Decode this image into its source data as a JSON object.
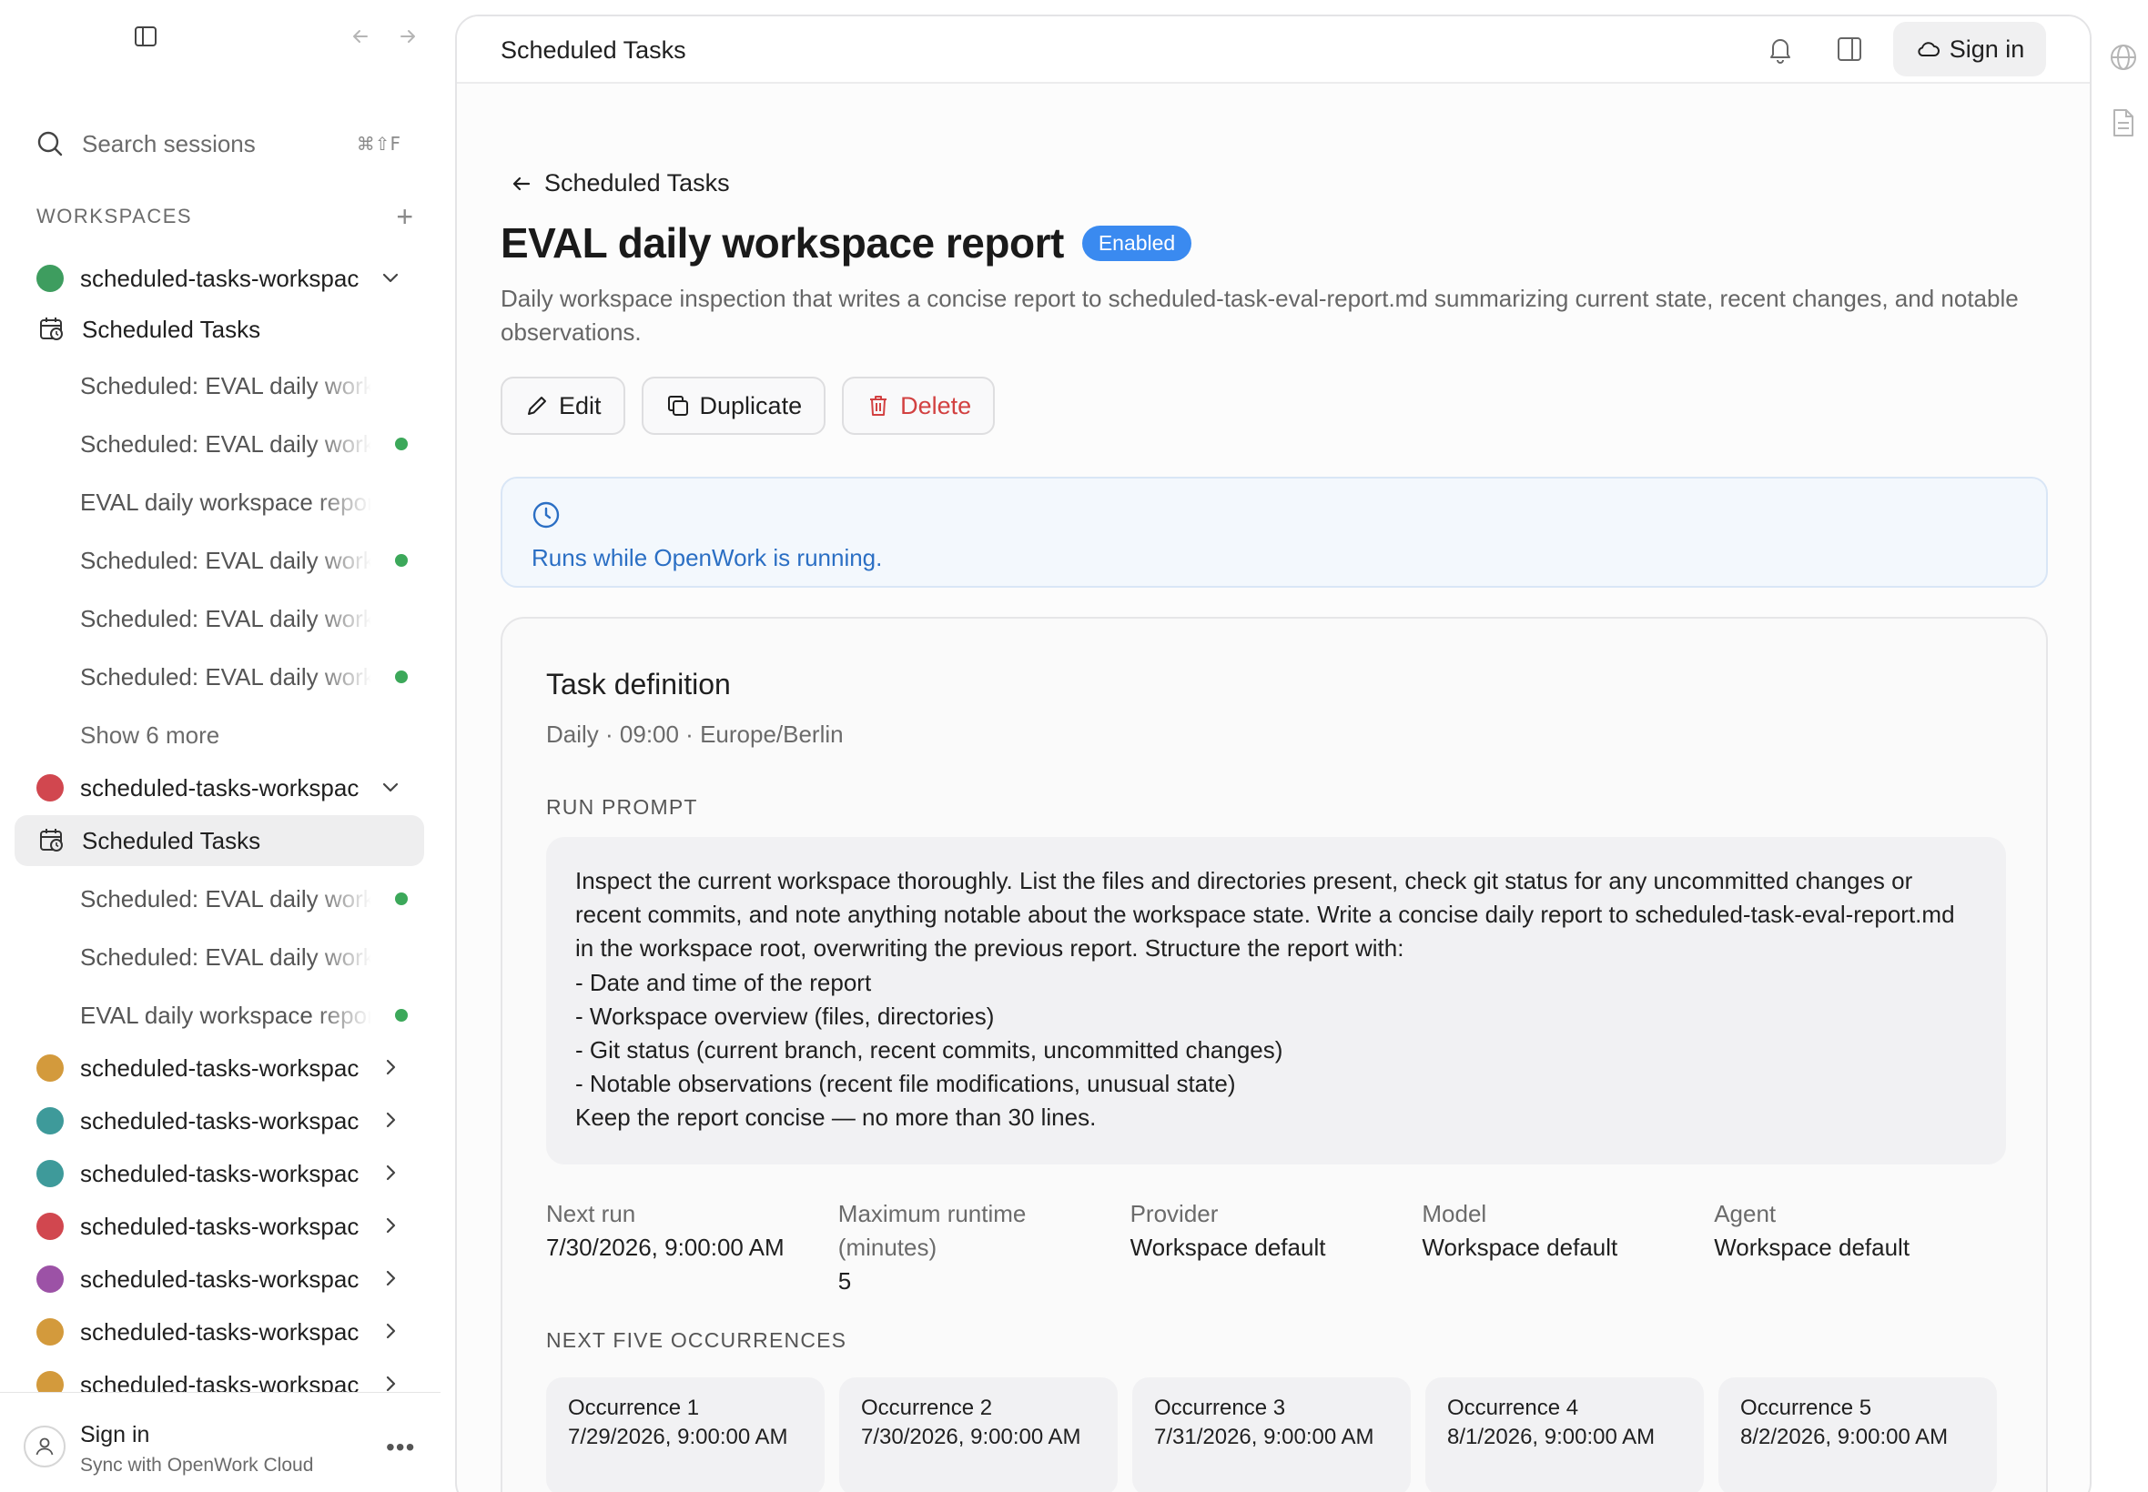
{
  "sidebar": {
    "search": {
      "label": "Search sessions",
      "shortcut": "⌘⇧F"
    },
    "workspaces_header": "WORKSPACES",
    "workspace_name": "scheduled-tasks-workspac",
    "scheduled_tasks_label": "Scheduled Tasks",
    "group1": {
      "color": "#3e9d5f",
      "items": [
        {
          "label": "Scheduled: EVAL daily workspace report",
          "dot": false
        },
        {
          "label": "Scheduled: EVAL daily workspace report",
          "dot": true
        },
        {
          "label": "EVAL daily workspace report",
          "dot": false
        },
        {
          "label": "Scheduled: EVAL daily workspace report",
          "dot": true
        },
        {
          "label": "Scheduled: EVAL daily workspace report",
          "dot": false
        },
        {
          "label": "Scheduled: EVAL daily workspace report",
          "dot": true
        }
      ],
      "show_more": "Show 6 more"
    },
    "group2": {
      "color": "#d1474f",
      "items": [
        {
          "label": "Scheduled: EVAL daily workspace report",
          "dot": true
        },
        {
          "label": "Scheduled: EVAL daily workspace report",
          "dot": false
        },
        {
          "label": "EVAL daily workspace report",
          "dot": true
        }
      ]
    },
    "collapsed_workspaces": [
      {
        "color": "#d39a3c"
      },
      {
        "color": "#3e9a9a"
      },
      {
        "color": "#3e9a9a"
      },
      {
        "color": "#d1474f"
      },
      {
        "color": "#9c52a6"
      },
      {
        "color": "#d39a3c"
      },
      {
        "color": "#d39a3c"
      }
    ],
    "footer": {
      "title": "Sign in",
      "subtitle": "Sync with OpenWork Cloud",
      "more": "•••"
    }
  },
  "topbar": {
    "title": "Scheduled Tasks",
    "signin_label": "Sign in"
  },
  "task": {
    "back_label": "Scheduled Tasks",
    "title": "EVAL daily workspace report",
    "status_badge": "Enabled",
    "description": "Daily workspace inspection that writes a concise report to scheduled-task-eval-report.md summarizing current state, recent changes, and notable observations.",
    "actions": {
      "edit": "Edit",
      "duplicate": "Duplicate",
      "delete": "Delete"
    },
    "notice": "Runs while OpenWork is running.",
    "definition": {
      "title": "Task definition",
      "schedule": "Daily · 09:00 · Europe/Berlin",
      "run_prompt_header": "RUN PROMPT",
      "run_prompt": "Inspect the current workspace thoroughly. List the files and directories present, check git status for any uncommitted changes or recent commits, and note anything notable about the workspace state. Write a concise daily report to scheduled-task-eval-report.md in the workspace root, overwriting the previous report. Structure the report with:\n- Date and time of the report\n- Workspace overview (files, directories)\n- Git status (current branch, recent commits, uncommitted changes)\n- Notable observations (recent file modifications, unusual state)\nKeep the report concise — no more than 30 lines.",
      "meta": [
        {
          "key": "Next run",
          "value": "7/30/2026, 9:00:00 AM"
        },
        {
          "key": "Maximum runtime (minutes)",
          "value": "5"
        },
        {
          "key": "Provider",
          "value": "Workspace default"
        },
        {
          "key": "Model",
          "value": "Workspace default"
        },
        {
          "key": "Agent",
          "value": "Workspace default"
        }
      ],
      "occurrences_header": "NEXT FIVE OCCURRENCES",
      "occurrences": [
        {
          "label": "Occurrence 1",
          "value": "7/29/2026, 9:00:00 AM"
        },
        {
          "label": "Occurrence 2",
          "value": "7/30/2026, 9:00:00 AM"
        },
        {
          "label": "Occurrence 3",
          "value": "7/31/2026, 9:00:00 AM"
        },
        {
          "label": "Occurrence 4",
          "value": "8/1/2026, 9:00:00 AM"
        },
        {
          "label": "Occurrence 5",
          "value": "8/2/2026, 9:00:00 AM"
        }
      ]
    }
  },
  "colors": {
    "accent": "#3a8af0",
    "danger": "#d24141",
    "active_dot": "#3ca85a",
    "notice_text": "#2b6fc4"
  }
}
